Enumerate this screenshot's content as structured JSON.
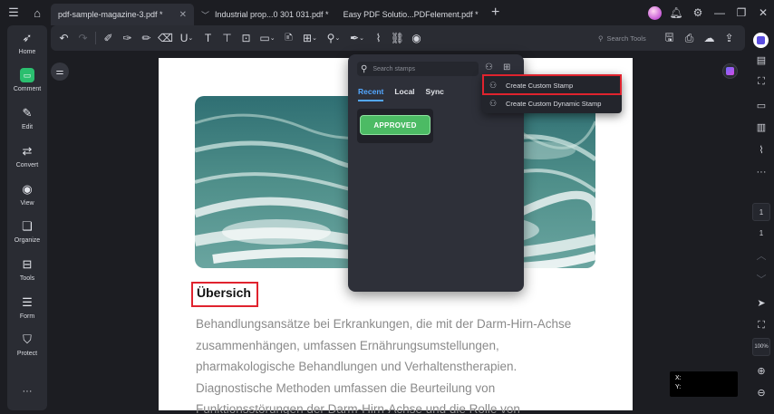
{
  "titlebar": {
    "tabs": [
      {
        "label": "pdf-sample-magazine-3.pdf *",
        "active": true
      },
      {
        "label": "Industrial  prop...0 301 031.pdf *",
        "active": false
      },
      {
        "label": "Easy PDF Solutio...PDFelement.pdf *",
        "active": false
      }
    ],
    "new_tab": "+"
  },
  "leftbar": {
    "items": [
      {
        "label": "Home",
        "icon": "rocket-icon"
      },
      {
        "label": "Comment",
        "icon": "comment-icon"
      },
      {
        "label": "Edit",
        "icon": "edit-icon"
      },
      {
        "label": "Convert",
        "icon": "convert-icon"
      },
      {
        "label": "View",
        "icon": "eye-icon"
      },
      {
        "label": "Organize",
        "icon": "organize-icon"
      },
      {
        "label": "Tools",
        "icon": "toolbox-icon"
      },
      {
        "label": "Form",
        "icon": "form-icon"
      },
      {
        "label": "Protect",
        "icon": "shield-icon"
      }
    ],
    "more": "···"
  },
  "toolbar": {
    "search_tools": "Search Tools"
  },
  "stamp_panel": {
    "search_placeholder": "Search stamps",
    "tabs": [
      "Recent",
      "Local",
      "Sync"
    ],
    "active_tab": "Recent",
    "stamp_label": "APPROVED"
  },
  "menu": {
    "items": [
      "Create Custom Stamp",
      "Create Custom Dynamic Stamp"
    ],
    "highlighted": "Create Custom Stamp"
  },
  "document": {
    "heading": "Übersich",
    "body_lines": [
      "Behandlungsansätze bei Erkrankungen, die mit der Darm-Hirn-Achse",
      "zusammenhängen, umfassen Ernährungsumstellungen,",
      "pharmakologische Behandlungen und Verhaltenstherapien.",
      "Diagnostische Methoden umfassen die Beurteilung von",
      "Funktionsstörungen der Darm-Hirn-Achse und die Rolle von"
    ]
  },
  "coords": {
    "x_label": "X:",
    "y_label": "Y:"
  },
  "rightbar": {
    "page_current": "1",
    "page_total": "1",
    "zoom": "100%"
  },
  "colors": {
    "accent_blue": "#53a7ff",
    "approved_green": "#4cbb64",
    "highlight_red": "#e0232e",
    "comment_green": "#2bbf6f"
  }
}
